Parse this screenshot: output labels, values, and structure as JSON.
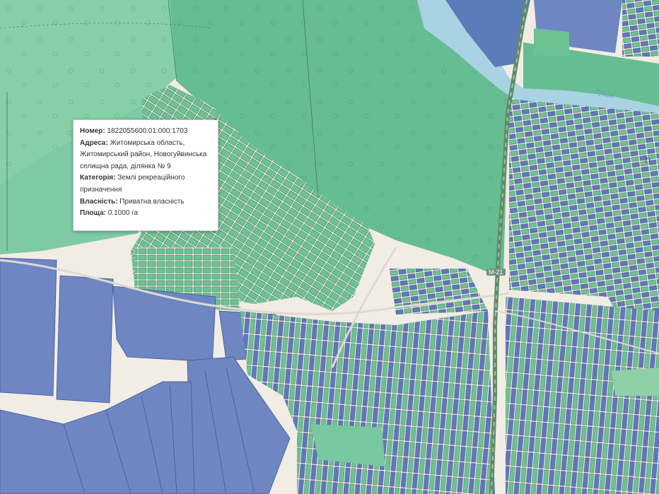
{
  "map": {
    "labels": {
      "river": "Гуйва",
      "road_shield": "М-21",
      "place_partial": "П"
    },
    "colors": {
      "background": "#f1ede4",
      "forest": "#66bd92",
      "forest_light": "#86cfa9",
      "parcel_green": "#6cc293",
      "parcel_blue": "#6e86c2",
      "water": "#a9d3e3",
      "road": "#7a9e82"
    }
  },
  "popup": {
    "number_label": "Номер:",
    "number_value": "1822055600:01:000:1703",
    "address_label": "Адреса:",
    "address_value": "Житомирська область, Житомирський район, Новогуйвинська селищна рада, ділянка № 9",
    "category_label": "Категорія:",
    "category_value": "Землі рекреаційного призначення",
    "ownership_label": "Власність:",
    "ownership_value": "Приватна власність",
    "area_label": "Площа:",
    "area_value": "0.1000 га"
  }
}
